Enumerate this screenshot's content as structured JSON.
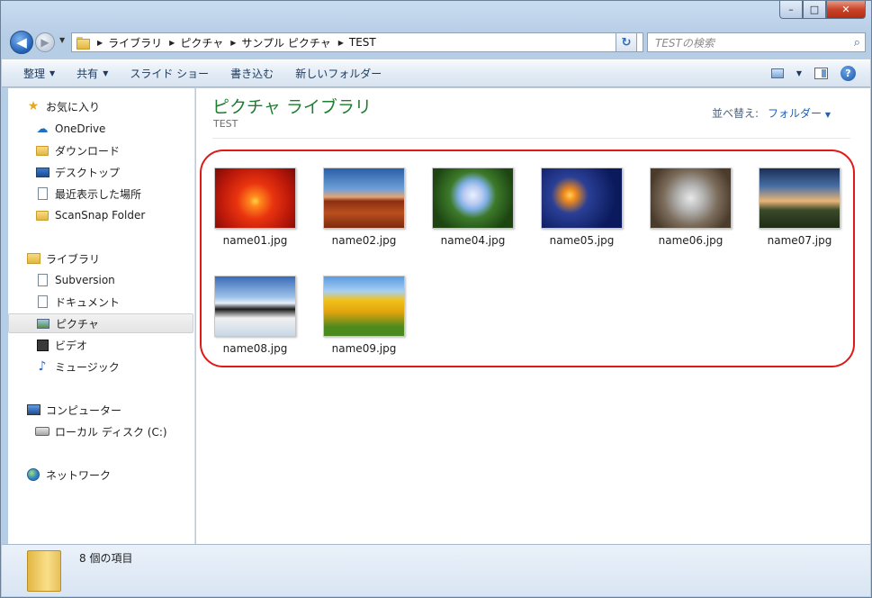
{
  "window": {
    "caption_buttons": {
      "minimize": "–",
      "maximize": "□",
      "close": "✕"
    }
  },
  "nav": {
    "back_icon": "arrow-left-icon",
    "forward_icon": "arrow-right-icon",
    "breadcrumb": [
      "ライブラリ",
      "ピクチャ",
      "サンプル ピクチャ",
      "TEST"
    ],
    "search_placeholder": "TESTの検索"
  },
  "toolbar": {
    "items": [
      {
        "label": "整理",
        "has_dropdown": true
      },
      {
        "label": "共有",
        "has_dropdown": true
      },
      {
        "label": "スライド ショー",
        "has_dropdown": false
      },
      {
        "label": "書き込む",
        "has_dropdown": false
      },
      {
        "label": "新しいフォルダー",
        "has_dropdown": false
      }
    ],
    "dropdown_arrow": "▼",
    "help_label": "?"
  },
  "sidebar": {
    "favorites": {
      "label": "お気に入り",
      "icon": "star-icon",
      "items": [
        {
          "label": "OneDrive",
          "icon": "cloud-icon"
        },
        {
          "label": "ダウンロード",
          "icon": "download-folder-icon"
        },
        {
          "label": "デスクトップ",
          "icon": "desktop-icon"
        },
        {
          "label": "最近表示した場所",
          "icon": "recent-places-icon"
        },
        {
          "label": "ScanSnap Folder",
          "icon": "folder-icon"
        }
      ]
    },
    "libraries": {
      "label": "ライブラリ",
      "icon": "library-icon",
      "items": [
        {
          "label": "Subversion",
          "icon": "document-icon"
        },
        {
          "label": "ドキュメント",
          "icon": "document-icon"
        },
        {
          "label": "ピクチャ",
          "icon": "pictures-icon",
          "selected": true
        },
        {
          "label": "ビデオ",
          "icon": "video-icon"
        },
        {
          "label": "ミュージック",
          "icon": "music-icon"
        }
      ]
    },
    "computer": {
      "label": "コンピューター",
      "icon": "computer-icon",
      "items": [
        {
          "label": "ローカル ディスク (C:)",
          "icon": "disk-icon"
        }
      ]
    },
    "network": {
      "label": "ネットワーク",
      "icon": "network-icon"
    }
  },
  "main": {
    "title": "ピクチャ ライブラリ",
    "subtitle": "TEST",
    "arrange_label": "並べ替え:",
    "arrange_value": "フォルダー",
    "arrange_arrow": "▼",
    "files": [
      {
        "name": "name01.jpg",
        "thumbnail": "orange-flower"
      },
      {
        "name": "name02.jpg",
        "thumbnail": "desert-mesa"
      },
      {
        "name": "name04.jpg",
        "thumbnail": "hydrangea"
      },
      {
        "name": "name05.jpg",
        "thumbnail": "jellyfish"
      },
      {
        "name": "name06.jpg",
        "thumbnail": "koala"
      },
      {
        "name": "name07.jpg",
        "thumbnail": "lighthouse"
      },
      {
        "name": "name08.jpg",
        "thumbnail": "penguins"
      },
      {
        "name": "name09.jpg",
        "thumbnail": "tulips"
      }
    ]
  },
  "details": {
    "count_text": "8 個の項目"
  },
  "colors": {
    "title_green": "#1e7d2f",
    "highlight_red": "#e01818",
    "link_blue": "#1e5fb8"
  }
}
